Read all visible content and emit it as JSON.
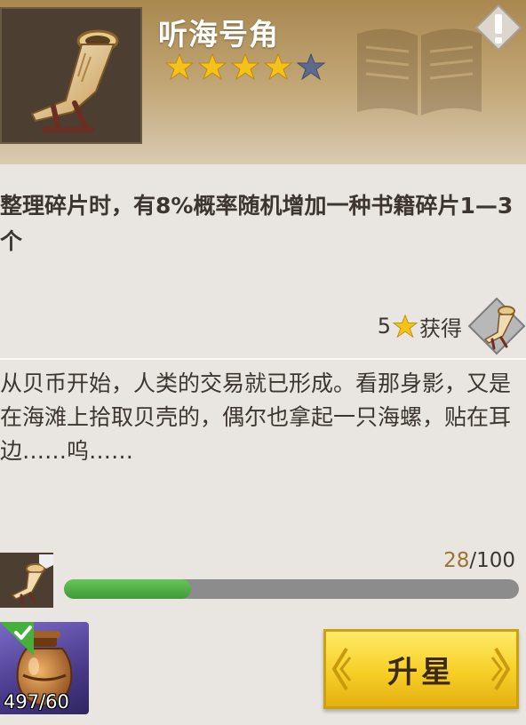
{
  "item": {
    "name": "听海号角",
    "stars_filled": 4,
    "stars_total": 5,
    "description": "整理碎片时，有8%概率随机增加一种书籍碎片1—3个"
  },
  "obtain": {
    "star_count": "5",
    "label": "获得"
  },
  "lore": "从贝币开始，人类的交易就已形成。看那身影，又是在海滩上拾取贝壳的，偶尔也拿起一只海螺，贴在耳边……呜……",
  "progress": {
    "current": "28",
    "separator": "/",
    "max": "100",
    "fraction": 0.28
  },
  "material": {
    "count": "497/60"
  },
  "upgrade_button": {
    "label": "升星"
  },
  "colors": {
    "star_gold": "#f5c21a",
    "star_empty": "#5c6a8c",
    "progress_green": "#4fae44",
    "button_gold": "#f6cf26"
  },
  "icons": [
    "horn-icon",
    "star-icon",
    "alert-icon",
    "book-icon",
    "potion-jar-icon",
    "check-icon",
    "fragment-icon"
  ]
}
